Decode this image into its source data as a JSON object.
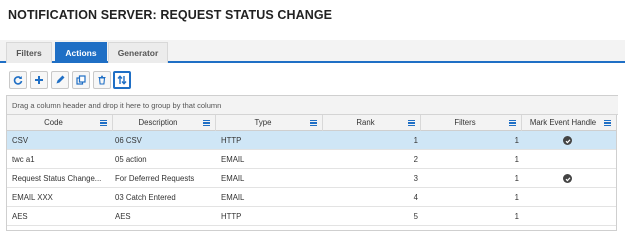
{
  "page": {
    "title": "NOTIFICATION SERVER: REQUEST STATUS CHANGE"
  },
  "tabs": [
    {
      "label": "Filters",
      "active": false
    },
    {
      "label": "Actions",
      "active": true
    },
    {
      "label": "Generator",
      "active": false
    }
  ],
  "toolbar": {
    "buttons": [
      {
        "icon": "refresh-icon"
      },
      {
        "icon": "plus-icon"
      },
      {
        "icon": "pencil-icon"
      },
      {
        "icon": "copy-icon"
      },
      {
        "icon": "trash-icon"
      },
      {
        "icon": "sort-icon",
        "selected": true
      }
    ]
  },
  "grid": {
    "group_hint": "Drag a column header and drop it here to group by that column",
    "columns": [
      "Code",
      "Description",
      "Type",
      "Rank",
      "Filters",
      "Mark Event Handle"
    ],
    "rows": [
      {
        "code": "CSV",
        "description": "06 CSV",
        "type": "HTTP",
        "rank": "1",
        "filters": "1",
        "mark": true,
        "selected": true
      },
      {
        "code": "twc a1",
        "description": "05 action",
        "type": "EMAIL",
        "rank": "2",
        "filters": "1",
        "mark": false,
        "selected": false
      },
      {
        "code": "Request Status Change...",
        "description": "For Deferred Requests",
        "type": "EMAIL",
        "rank": "3",
        "filters": "1",
        "mark": true,
        "selected": false
      },
      {
        "code": "EMAIL XXX",
        "description": "03 Catch Entered",
        "type": "EMAIL",
        "rank": "4",
        "filters": "1",
        "mark": false,
        "selected": false
      },
      {
        "code": "AES",
        "description": "AES",
        "type": "HTTP",
        "rank": "5",
        "filters": "1",
        "mark": false,
        "selected": false
      }
    ]
  },
  "colors": {
    "accent": "#1f6fc5",
    "selected_row": "#cfe6f6",
    "header_bg": "#f3f3f3"
  }
}
